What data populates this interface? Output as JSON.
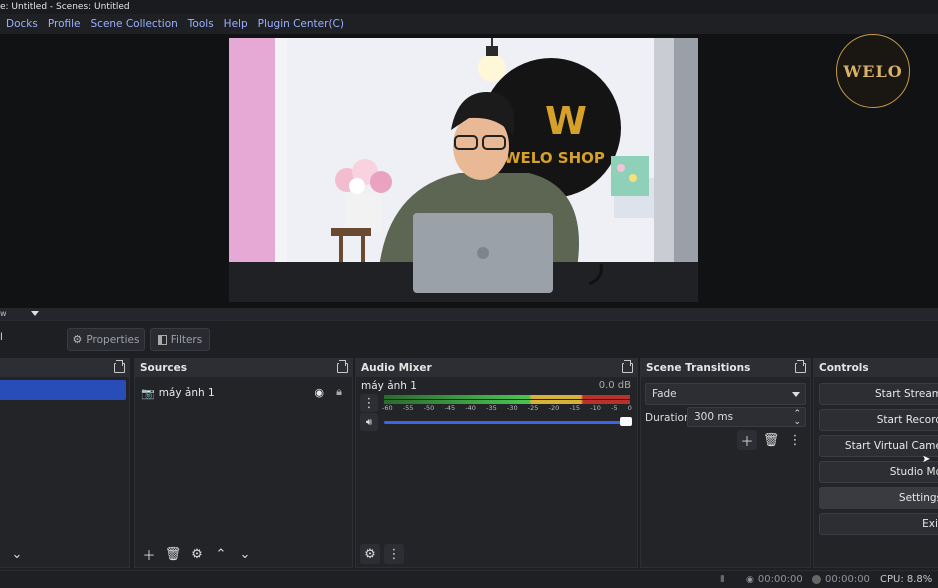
{
  "window": {
    "title": "e: Untitled - Scenes: Untitled"
  },
  "menu": [
    "Docks",
    "Profile",
    "Scene Collection",
    "Tools",
    "Help",
    "Plugin Center(C)"
  ],
  "preview": {
    "logo_text": "WELO",
    "shop_sign": "WELO SHOP",
    "wall_sign_letter": "W"
  },
  "mini_bar": {
    "label": "w"
  },
  "toolbar": {
    "left_label": "l",
    "properties_label": "Properties",
    "filters_label": "Filters"
  },
  "docks": {
    "sources": {
      "title": "Sources",
      "items": [
        {
          "name": "máy ảnh 1",
          "icon": "camera-icon"
        }
      ]
    },
    "audio_mixer": {
      "title": "Audio Mixer",
      "channel": {
        "name": "máy ảnh 1",
        "db": "0.0 dB",
        "scale": [
          "-60",
          "-55",
          "-50",
          "-45",
          "-40",
          "-35",
          "-30",
          "-25",
          "-20",
          "-15",
          "-10",
          "-5",
          "0"
        ],
        "volume_level": 1.0
      }
    },
    "scene_transitions": {
      "title": "Scene Transitions",
      "transition": "Fade",
      "duration_label": "Duration",
      "duration_value": "300 ms"
    },
    "controls": {
      "title": "Controls",
      "buttons": [
        "Start Stream",
        "Start Record",
        "Start Virtual Came",
        "Studio Mo",
        "Settings",
        "Exit"
      ]
    }
  },
  "status": {
    "stream_time": "00:00:00",
    "record_time": "00:00:00",
    "cpu": "CPU: 8.8%"
  },
  "colors": {
    "accent": "#284cb8",
    "menu_text": "#9bb0ff",
    "meter_green": "#4caf50",
    "meter_yellow": "#d6b23a",
    "meter_red": "#c0392b"
  }
}
